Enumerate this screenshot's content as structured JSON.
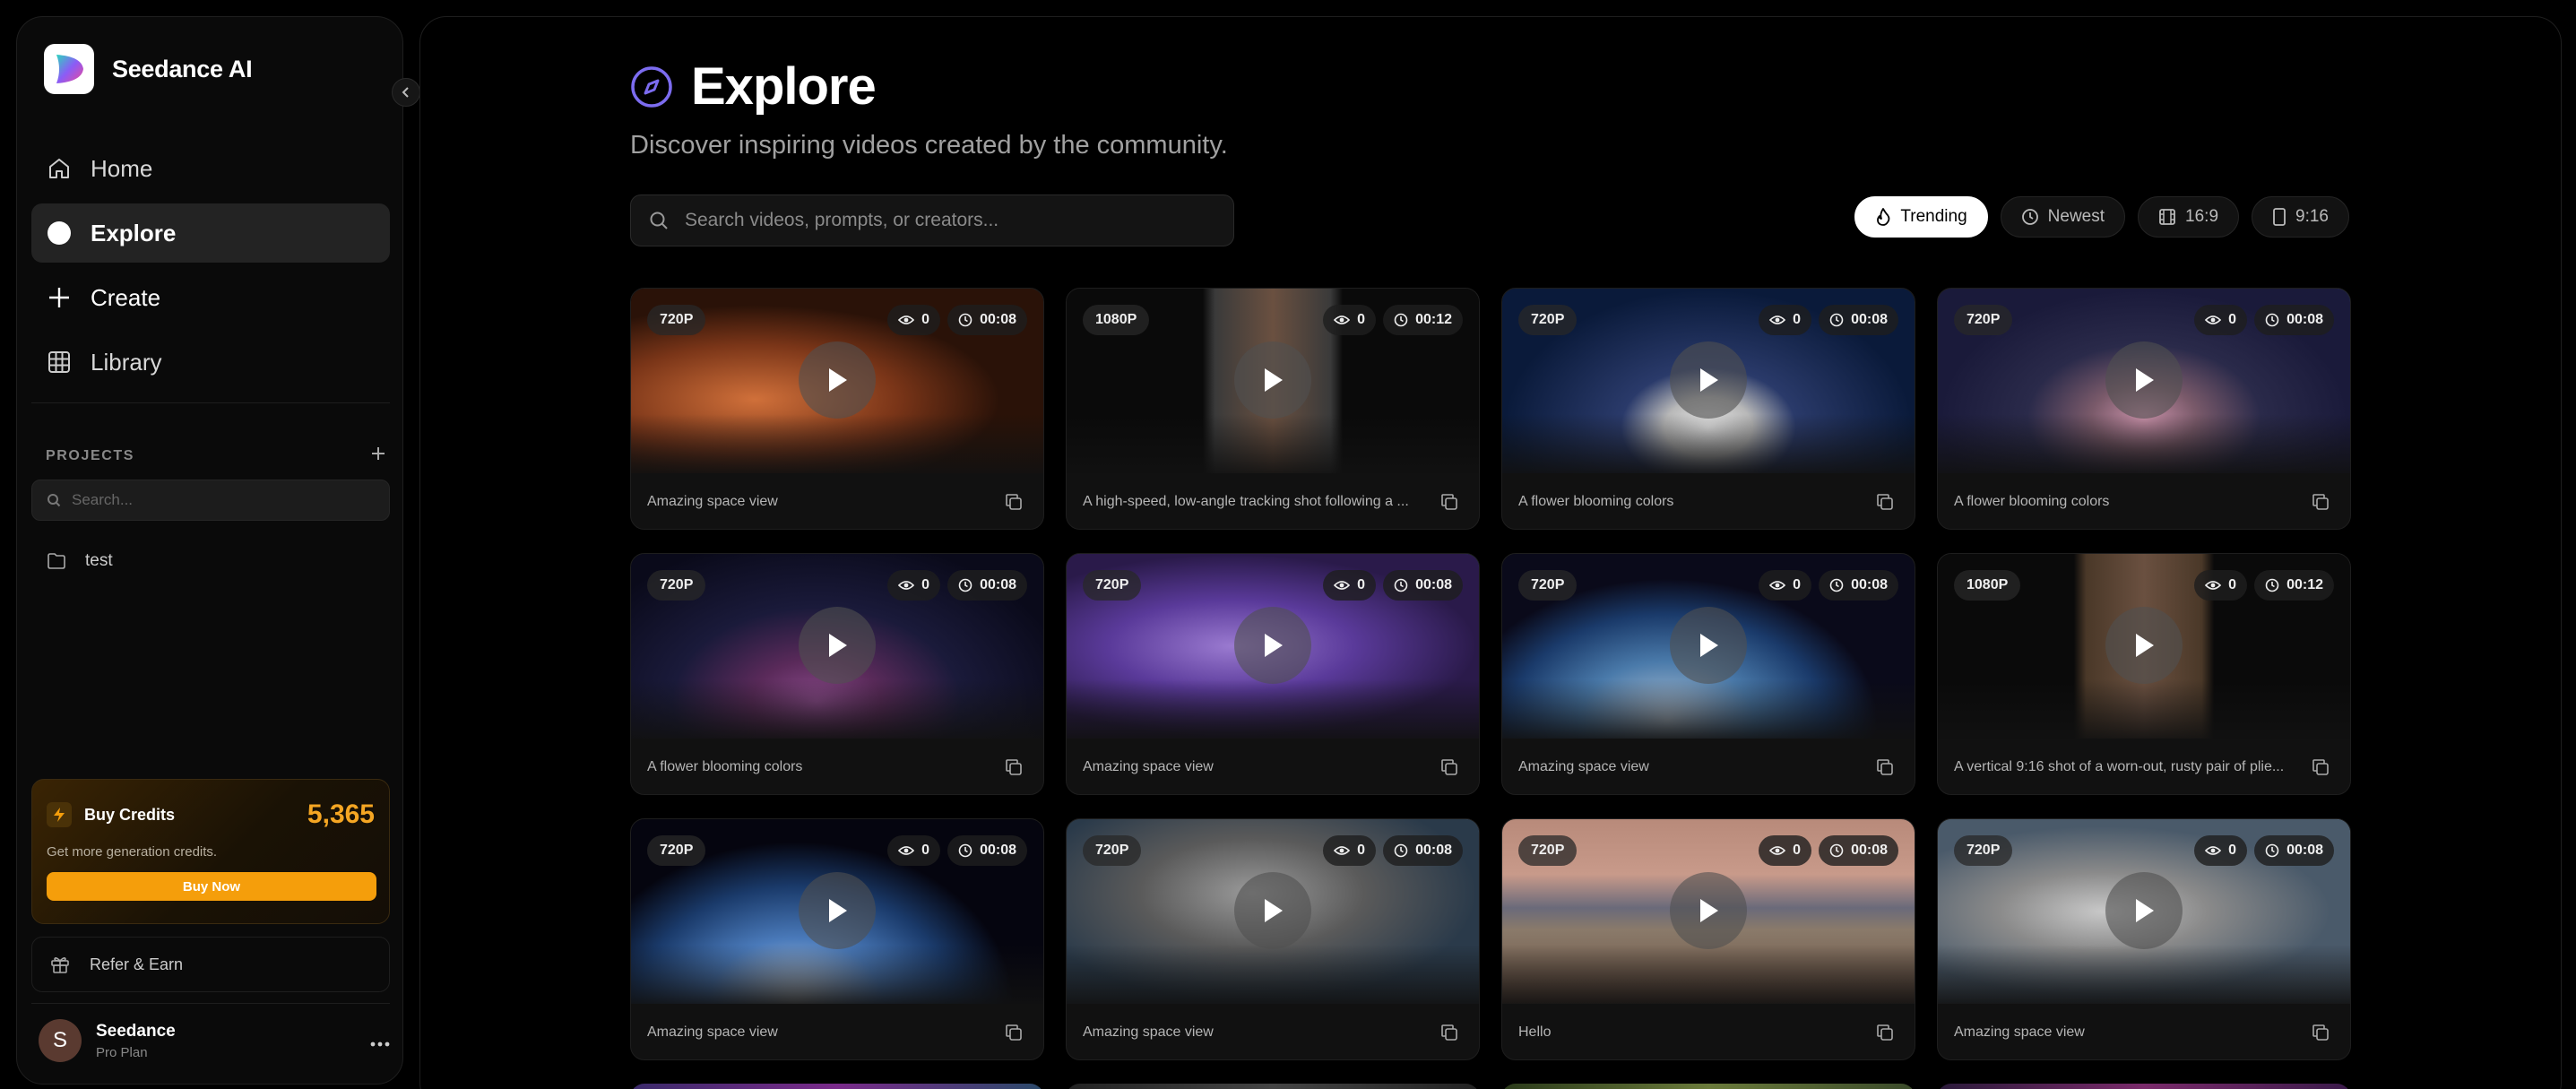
{
  "brand": {
    "name": "Seedance AI"
  },
  "nav": [
    {
      "label": "Home",
      "icon": "home-icon",
      "active": false
    },
    {
      "label": "Explore",
      "icon": "explore-dot-icon",
      "active": true
    },
    {
      "label": "Create",
      "icon": "plus-icon",
      "active": false
    },
    {
      "label": "Library",
      "icon": "grid-icon",
      "active": false
    }
  ],
  "projects": {
    "header": "PROJECTS",
    "search_placeholder": "Search...",
    "items": [
      {
        "name": "test"
      }
    ]
  },
  "credits": {
    "title": "Buy Credits",
    "amount": "5,365",
    "subtitle": "Get more generation credits.",
    "button": "Buy Now",
    "accent": "#f59e0b"
  },
  "refer": {
    "label": "Refer & Earn"
  },
  "user": {
    "initial": "S",
    "name": "Seedance",
    "plan": "Pro Plan"
  },
  "page": {
    "title": "Explore",
    "subtitle": "Discover inspiring videos created by the community.",
    "search_placeholder": "Search videos, prompts, or creators..."
  },
  "filters": [
    {
      "label": "Trending",
      "icon": "flame-icon",
      "active": true
    },
    {
      "label": "Newest",
      "icon": "clock-icon",
      "active": false
    },
    {
      "label": "16:9",
      "icon": "film-icon",
      "active": false
    },
    {
      "label": "9:16",
      "icon": "phone-icon",
      "active": false
    }
  ],
  "videos": [
    {
      "res": "720P",
      "views": "0",
      "duration": "00:08",
      "caption": "Amazing space view"
    },
    {
      "res": "1080P",
      "views": "0",
      "duration": "00:12",
      "caption": "A high-speed, low-angle tracking shot following a ..."
    },
    {
      "res": "720P",
      "views": "0",
      "duration": "00:08",
      "caption": "A flower blooming colors"
    },
    {
      "res": "720P",
      "views": "0",
      "duration": "00:08",
      "caption": "A flower blooming colors"
    },
    {
      "res": "720P",
      "views": "0",
      "duration": "00:08",
      "caption": "A flower blooming colors"
    },
    {
      "res": "720P",
      "views": "0",
      "duration": "00:08",
      "caption": "Amazing space view"
    },
    {
      "res": "720P",
      "views": "0",
      "duration": "00:08",
      "caption": "Amazing space view"
    },
    {
      "res": "1080P",
      "views": "0",
      "duration": "00:12",
      "caption": "A vertical 9:16 shot of a worn-out, rusty pair of plie..."
    },
    {
      "res": "720P",
      "views": "0",
      "duration": "00:08",
      "caption": "Amazing space view"
    },
    {
      "res": "720P",
      "views": "0",
      "duration": "00:08",
      "caption": "Amazing space view"
    },
    {
      "res": "720P",
      "views": "0",
      "duration": "00:08",
      "caption": "Hello"
    },
    {
      "res": "720P",
      "views": "0",
      "duration": "00:08",
      "caption": "Amazing space view"
    }
  ]
}
